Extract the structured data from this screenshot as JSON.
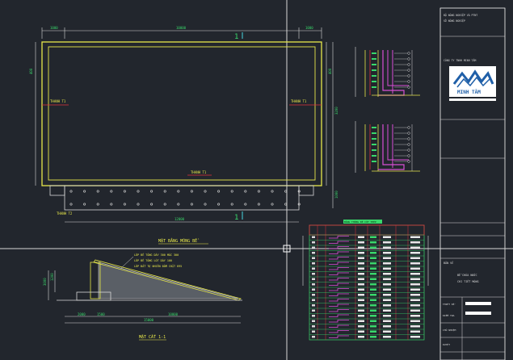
{
  "drawing": {
    "plan_top_dims": [
      "1000",
      "10000",
      "1000"
    ],
    "plan_bottom_dims": [
      "1000",
      "10000",
      "1000"
    ],
    "plan_total_dim": "12000",
    "plan_left_dims": [
      "400",
      "1000"
    ],
    "plan_right_dims": [
      "400",
      "3200",
      "1000"
    ],
    "section_marker": "1",
    "slab_labels": [
      "THANH T1",
      "THANH T1",
      "THANH T1",
      "THANH T2"
    ],
    "plan_title": "MẶT BẰNG MÓNG BỂ",
    "section_title": "MẶT CẮT 1-1",
    "section_notes": [
      "LỚP BÊ TÔNG DÀY 300 MÁC 300",
      "LỚP BÊ TÔNG LÓT DÀY 100",
      "LỚP ĐẤT TỰ NHIÊN ĐẦM CHẶT K95"
    ],
    "section_dims_left": [
      "3000",
      "1200"
    ],
    "section_dims_bottom": [
      "2000",
      "1500",
      "10000"
    ],
    "section_total": "15000"
  },
  "title_block": {
    "logo_text": "MINH TÂM",
    "header_lines": [
      "BỘ NÔNG NGHIỆP VÀ PTNT",
      "SỞ NÔNG NGHIỆP",
      "CÔNG TY TNHH MINH TÂM"
    ],
    "sheet_label": "BẢN VẼ",
    "sheet_title_lines": [
      "BỂ CHỨA NƯỚC",
      "CHI TIẾT MÓNG"
    ],
    "stamp_labels": [
      "THIẾT KẾ",
      "KIỂM TRA",
      "CHỦ NHIỆM",
      "DUYỆT"
    ]
  },
  "table": {
    "title": "BẢNG THỐNG KÊ CỐT THÉP",
    "headers": [
      "STT",
      "HÌNH DẠNG",
      "Ø",
      "DÀI",
      "SL",
      "TỔNG",
      "KL"
    ],
    "rows": 20
  },
  "colors": {
    "background": "#22262d",
    "yellow": "#e8e84a",
    "white": "#e8e8e8",
    "green": "#39d86b",
    "red": "#e0303a",
    "magenta": "#d94fd6",
    "cyan": "#45d6e0",
    "blue": "#1f5fa8"
  }
}
